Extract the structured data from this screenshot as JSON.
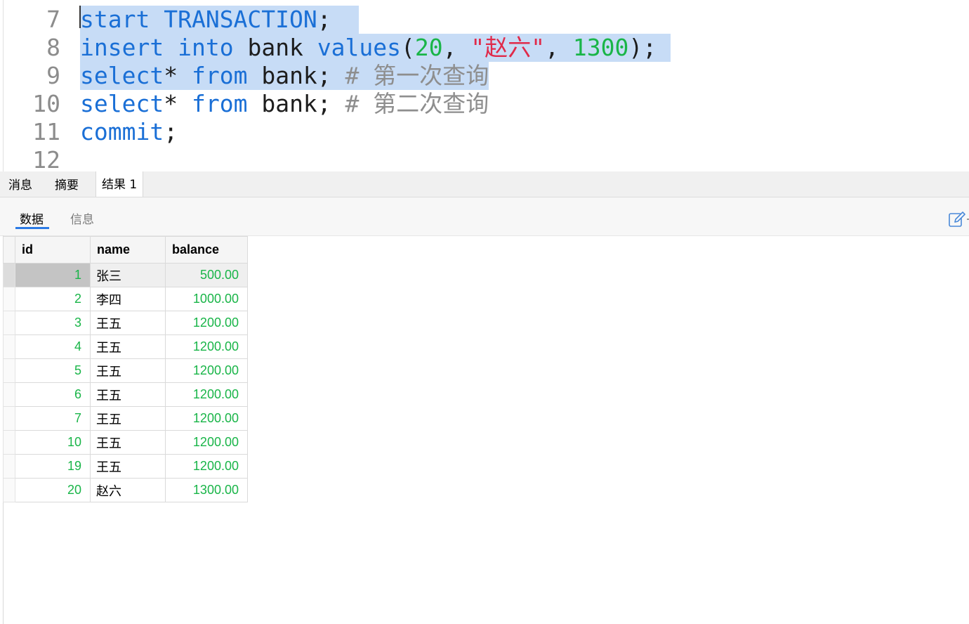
{
  "editor": {
    "lines": [
      {
        "no": "7"
      },
      {
        "no": "8"
      },
      {
        "no": "9"
      },
      {
        "no": "10"
      },
      {
        "no": "11"
      },
      {
        "no": "12"
      }
    ],
    "tokens": {
      "l7_kw1": "start",
      "l7_kw2": "TRANSACTION",
      "l7_semi": ";",
      "l8_kw1": "insert",
      "l8_kw2": "into",
      "l8_ident": "bank",
      "l8_kw3": "values",
      "l8_open": "(",
      "l8_num1": "20",
      "l8_comma1": ", ",
      "l8_str": "\"赵六\"",
      "l8_comma2": ", ",
      "l8_num2": "1300",
      "l8_close": ");",
      "l9_kw1": "select",
      "l9_star": "*",
      "l9_kw2": "from",
      "l9_ident": "bank;",
      "l9_comment": "# 第一次查询",
      "l10_kw1": "select",
      "l10_star": "*",
      "l10_kw2": "from",
      "l10_ident": "bank;",
      "l10_comment": "# 第二次查询",
      "l11_kw": "commit",
      "l11_semi": ";"
    }
  },
  "bottom_tabs": [
    "消息",
    "摘要",
    "结果 1"
  ],
  "sub_tabs": [
    "数据",
    "信息"
  ],
  "grid": {
    "columns": [
      "id",
      "name",
      "balance"
    ],
    "rows": [
      {
        "id": "1",
        "name": "张三",
        "balance": "500.00"
      },
      {
        "id": "2",
        "name": "李四",
        "balance": "1000.00"
      },
      {
        "id": "3",
        "name": "王五",
        "balance": "1200.00"
      },
      {
        "id": "4",
        "name": "王五",
        "balance": "1200.00"
      },
      {
        "id": "5",
        "name": "王五",
        "balance": "1200.00"
      },
      {
        "id": "6",
        "name": "王五",
        "balance": "1200.00"
      },
      {
        "id": "7",
        "name": "王五",
        "balance": "1200.00"
      },
      {
        "id": "10",
        "name": "王五",
        "balance": "1200.00"
      },
      {
        "id": "19",
        "name": "王五",
        "balance": "1200.00"
      },
      {
        "id": "20",
        "name": "赵六",
        "balance": "1300.00"
      }
    ]
  },
  "colors": {
    "keyword": "#1a6fd6",
    "number": "#19b548",
    "string": "#e02a4a",
    "comment": "#8e8e8e",
    "selection": "#c7dcf6",
    "tab_underline": "#2c7be5"
  },
  "icons": {
    "edit": "pencil-edit-icon"
  }
}
